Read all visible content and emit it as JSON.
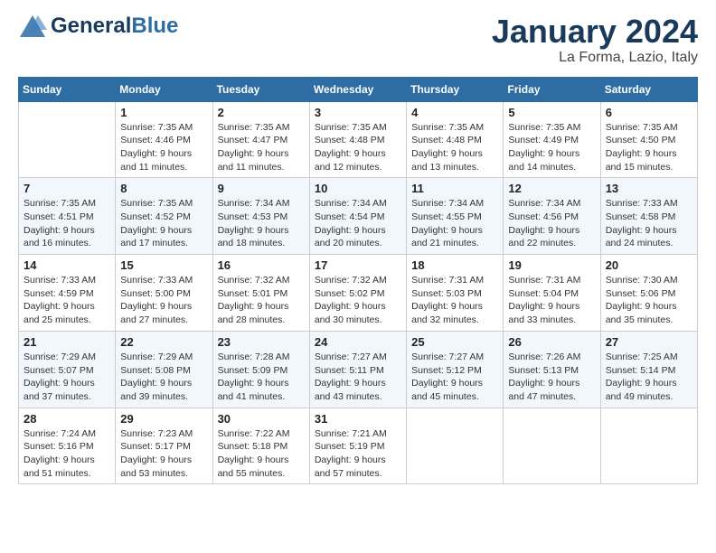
{
  "header": {
    "logo_general": "General",
    "logo_blue": "Blue",
    "month_title": "January 2024",
    "location": "La Forma, Lazio, Italy"
  },
  "weekdays": [
    "Sunday",
    "Monday",
    "Tuesday",
    "Wednesday",
    "Thursday",
    "Friday",
    "Saturday"
  ],
  "weeks": [
    [
      {
        "day": "",
        "sunrise": "",
        "sunset": "",
        "daylight": ""
      },
      {
        "day": "1",
        "sunrise": "Sunrise: 7:35 AM",
        "sunset": "Sunset: 4:46 PM",
        "daylight": "Daylight: 9 hours and 11 minutes."
      },
      {
        "day": "2",
        "sunrise": "Sunrise: 7:35 AM",
        "sunset": "Sunset: 4:47 PM",
        "daylight": "Daylight: 9 hours and 11 minutes."
      },
      {
        "day": "3",
        "sunrise": "Sunrise: 7:35 AM",
        "sunset": "Sunset: 4:48 PM",
        "daylight": "Daylight: 9 hours and 12 minutes."
      },
      {
        "day": "4",
        "sunrise": "Sunrise: 7:35 AM",
        "sunset": "Sunset: 4:48 PM",
        "daylight": "Daylight: 9 hours and 13 minutes."
      },
      {
        "day": "5",
        "sunrise": "Sunrise: 7:35 AM",
        "sunset": "Sunset: 4:49 PM",
        "daylight": "Daylight: 9 hours and 14 minutes."
      },
      {
        "day": "6",
        "sunrise": "Sunrise: 7:35 AM",
        "sunset": "Sunset: 4:50 PM",
        "daylight": "Daylight: 9 hours and 15 minutes."
      }
    ],
    [
      {
        "day": "7",
        "sunrise": "Sunrise: 7:35 AM",
        "sunset": "Sunset: 4:51 PM",
        "daylight": "Daylight: 9 hours and 16 minutes."
      },
      {
        "day": "8",
        "sunrise": "Sunrise: 7:35 AM",
        "sunset": "Sunset: 4:52 PM",
        "daylight": "Daylight: 9 hours and 17 minutes."
      },
      {
        "day": "9",
        "sunrise": "Sunrise: 7:34 AM",
        "sunset": "Sunset: 4:53 PM",
        "daylight": "Daylight: 9 hours and 18 minutes."
      },
      {
        "day": "10",
        "sunrise": "Sunrise: 7:34 AM",
        "sunset": "Sunset: 4:54 PM",
        "daylight": "Daylight: 9 hours and 20 minutes."
      },
      {
        "day": "11",
        "sunrise": "Sunrise: 7:34 AM",
        "sunset": "Sunset: 4:55 PM",
        "daylight": "Daylight: 9 hours and 21 minutes."
      },
      {
        "day": "12",
        "sunrise": "Sunrise: 7:34 AM",
        "sunset": "Sunset: 4:56 PM",
        "daylight": "Daylight: 9 hours and 22 minutes."
      },
      {
        "day": "13",
        "sunrise": "Sunrise: 7:33 AM",
        "sunset": "Sunset: 4:58 PM",
        "daylight": "Daylight: 9 hours and 24 minutes."
      }
    ],
    [
      {
        "day": "14",
        "sunrise": "Sunrise: 7:33 AM",
        "sunset": "Sunset: 4:59 PM",
        "daylight": "Daylight: 9 hours and 25 minutes."
      },
      {
        "day": "15",
        "sunrise": "Sunrise: 7:33 AM",
        "sunset": "Sunset: 5:00 PM",
        "daylight": "Daylight: 9 hours and 27 minutes."
      },
      {
        "day": "16",
        "sunrise": "Sunrise: 7:32 AM",
        "sunset": "Sunset: 5:01 PM",
        "daylight": "Daylight: 9 hours and 28 minutes."
      },
      {
        "day": "17",
        "sunrise": "Sunrise: 7:32 AM",
        "sunset": "Sunset: 5:02 PM",
        "daylight": "Daylight: 9 hours and 30 minutes."
      },
      {
        "day": "18",
        "sunrise": "Sunrise: 7:31 AM",
        "sunset": "Sunset: 5:03 PM",
        "daylight": "Daylight: 9 hours and 32 minutes."
      },
      {
        "day": "19",
        "sunrise": "Sunrise: 7:31 AM",
        "sunset": "Sunset: 5:04 PM",
        "daylight": "Daylight: 9 hours and 33 minutes."
      },
      {
        "day": "20",
        "sunrise": "Sunrise: 7:30 AM",
        "sunset": "Sunset: 5:06 PM",
        "daylight": "Daylight: 9 hours and 35 minutes."
      }
    ],
    [
      {
        "day": "21",
        "sunrise": "Sunrise: 7:29 AM",
        "sunset": "Sunset: 5:07 PM",
        "daylight": "Daylight: 9 hours and 37 minutes."
      },
      {
        "day": "22",
        "sunrise": "Sunrise: 7:29 AM",
        "sunset": "Sunset: 5:08 PM",
        "daylight": "Daylight: 9 hours and 39 minutes."
      },
      {
        "day": "23",
        "sunrise": "Sunrise: 7:28 AM",
        "sunset": "Sunset: 5:09 PM",
        "daylight": "Daylight: 9 hours and 41 minutes."
      },
      {
        "day": "24",
        "sunrise": "Sunrise: 7:27 AM",
        "sunset": "Sunset: 5:11 PM",
        "daylight": "Daylight: 9 hours and 43 minutes."
      },
      {
        "day": "25",
        "sunrise": "Sunrise: 7:27 AM",
        "sunset": "Sunset: 5:12 PM",
        "daylight": "Daylight: 9 hours and 45 minutes."
      },
      {
        "day": "26",
        "sunrise": "Sunrise: 7:26 AM",
        "sunset": "Sunset: 5:13 PM",
        "daylight": "Daylight: 9 hours and 47 minutes."
      },
      {
        "day": "27",
        "sunrise": "Sunrise: 7:25 AM",
        "sunset": "Sunset: 5:14 PM",
        "daylight": "Daylight: 9 hours and 49 minutes."
      }
    ],
    [
      {
        "day": "28",
        "sunrise": "Sunrise: 7:24 AM",
        "sunset": "Sunset: 5:16 PM",
        "daylight": "Daylight: 9 hours and 51 minutes."
      },
      {
        "day": "29",
        "sunrise": "Sunrise: 7:23 AM",
        "sunset": "Sunset: 5:17 PM",
        "daylight": "Daylight: 9 hours and 53 minutes."
      },
      {
        "day": "30",
        "sunrise": "Sunrise: 7:22 AM",
        "sunset": "Sunset: 5:18 PM",
        "daylight": "Daylight: 9 hours and 55 minutes."
      },
      {
        "day": "31",
        "sunrise": "Sunrise: 7:21 AM",
        "sunset": "Sunset: 5:19 PM",
        "daylight": "Daylight: 9 hours and 57 minutes."
      },
      {
        "day": "",
        "sunrise": "",
        "sunset": "",
        "daylight": ""
      },
      {
        "day": "",
        "sunrise": "",
        "sunset": "",
        "daylight": ""
      },
      {
        "day": "",
        "sunrise": "",
        "sunset": "",
        "daylight": ""
      }
    ]
  ]
}
